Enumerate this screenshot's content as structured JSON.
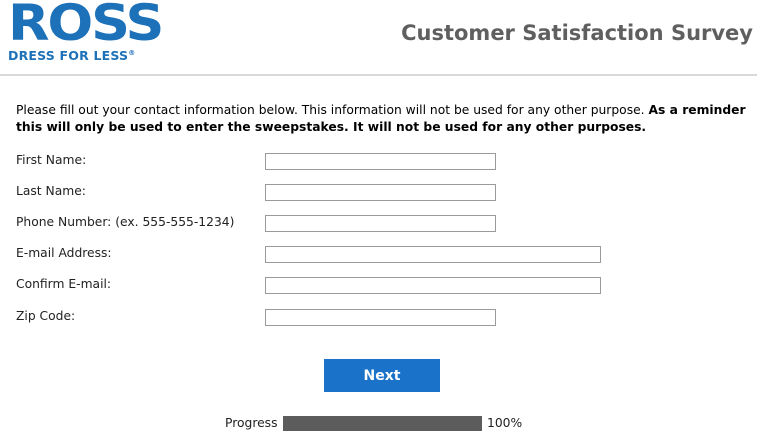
{
  "header": {
    "logo_word": "ROSS",
    "logo_tagline": "DRESS FOR LESS",
    "logo_mark": "®",
    "survey_title": "Customer Satisfaction Survey"
  },
  "intro": {
    "text": "Please fill out your contact information below. This information will not be used for any other purpose.",
    "bold_text": "As a reminder this will only be used to enter the sweepstakes. It will not be used for any other purposes."
  },
  "form": {
    "first_name_label": "First Name:",
    "first_name_value": "",
    "last_name_label": "Last Name:",
    "last_name_value": "",
    "phone_label": "Phone Number: (ex. 555-555-1234)",
    "phone_value": "",
    "email_label": "E-mail Address:",
    "email_value": "",
    "confirm_email_label": "Confirm E-mail:",
    "confirm_email_value": "",
    "zip_label": "Zip Code:",
    "zip_value": ""
  },
  "next_button_label": "Next",
  "progress": {
    "label": "Progress",
    "value_text": "100%",
    "fraction": 1.0
  },
  "colors": {
    "brand_blue": "#1d71b8",
    "button_blue": "#1a73c9",
    "title_gray": "#5f5f5f",
    "progress_fill": "#5c5c5c"
  }
}
